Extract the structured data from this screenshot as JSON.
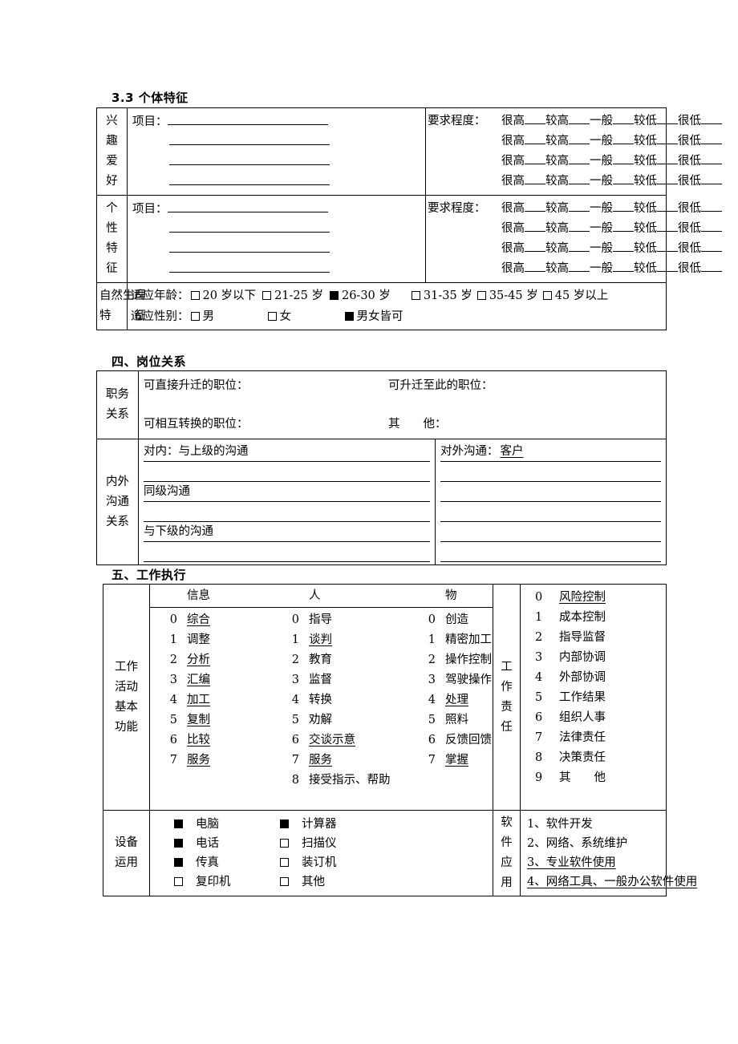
{
  "headings": {
    "individual": "3.3  个体特征",
    "relation": "四、岗位关系",
    "execution": "五、工作执行"
  },
  "individual": {
    "hobby": {
      "label": [
        "兴",
        "趣",
        "爱",
        "好"
      ],
      "item_label": "项目：",
      "rows": 4
    },
    "personality": {
      "label": [
        "个",
        "性",
        "特",
        "征"
      ],
      "item_label": "项目：",
      "rows": 4
    },
    "degree_label": "要求程度：",
    "degree_options": [
      "很高",
      "较高",
      "一般",
      "较低",
      "很低"
    ],
    "natural": {
      "label_line1": "自然生理",
      "label_line2": "特　　征",
      "age_label": "适应年龄：",
      "age_options": [
        {
          "text": "20 岁以下",
          "checked": false
        },
        {
          "text": "21-25 岁",
          "checked": false
        },
        {
          "text": "26-30 岁",
          "checked": true
        },
        {
          "text": "31-35 岁",
          "checked": false
        },
        {
          "text": "35-45 岁",
          "checked": false
        },
        {
          "text": "45 岁以上",
          "checked": false
        }
      ],
      "gender_label": "适应性别：",
      "gender_options": [
        {
          "text": "男",
          "checked": false
        },
        {
          "text": "女",
          "checked": false
        },
        {
          "text": "男女皆可",
          "checked": true
        }
      ]
    }
  },
  "relation": {
    "duty_label": [
      "职务",
      "关系"
    ],
    "promote_from": "可直接升迁的职位：",
    "promote_to": "可升迁至此的职位：",
    "transfer": "可相互转换的职位：",
    "other": "其　　他：",
    "comm_label": [
      "内外",
      "沟通",
      "关系"
    ],
    "internal": [
      "对内：与上级的沟通",
      "同级沟通",
      "与下级的沟通"
    ],
    "external_label": "对外沟通：",
    "external_value": "客户"
  },
  "execution": {
    "function_label": [
      "工作",
      "活动",
      "基本",
      "功能"
    ],
    "columns": [
      {
        "header": "信息",
        "items": [
          {
            "num": "0",
            "text": "综合",
            "underline": true
          },
          {
            "num": "1",
            "text": "调整",
            "underline": false
          },
          {
            "num": "2",
            "text": "分析",
            "underline": true
          },
          {
            "num": "3",
            "text": "汇编",
            "underline": true
          },
          {
            "num": "4",
            "text": "加工",
            "underline": true
          },
          {
            "num": "5",
            "text": "复制",
            "underline": true
          },
          {
            "num": "6",
            "text": "比较",
            "underline": true
          },
          {
            "num": "7",
            "text": "服务",
            "underline": true
          }
        ]
      },
      {
        "header": "人",
        "items": [
          {
            "num": "0",
            "text": "指导",
            "underline": false
          },
          {
            "num": "1",
            "text": "谈判",
            "underline": true
          },
          {
            "num": "2",
            "text": "教育",
            "underline": false
          },
          {
            "num": "3",
            "text": "监督",
            "underline": false
          },
          {
            "num": "4",
            "text": "转换",
            "underline": false
          },
          {
            "num": "5",
            "text": "劝解",
            "underline": false
          },
          {
            "num": "6",
            "text": "交谈示意",
            "underline": true
          },
          {
            "num": "7",
            "text": "服务",
            "underline": true
          },
          {
            "num": "8",
            "text": "接受指示、帮助",
            "underline": false
          }
        ]
      },
      {
        "header": "物",
        "items": [
          {
            "num": "0",
            "text": "创造",
            "underline": false
          },
          {
            "num": "1",
            "text": "精密加工",
            "underline": false
          },
          {
            "num": "2",
            "text": "操作控制",
            "underline": false
          },
          {
            "num": "3",
            "text": "驾驶操作",
            "underline": false
          },
          {
            "num": "4",
            "text": "处理",
            "underline": true
          },
          {
            "num": "5",
            "text": "照料",
            "underline": false
          },
          {
            "num": "6",
            "text": "反馈回馈",
            "underline": false
          },
          {
            "num": "7",
            "text": "掌握",
            "underline": true
          }
        ]
      }
    ],
    "responsibility_label": [
      "工",
      "作",
      "责",
      "任"
    ],
    "responsibility": [
      {
        "num": "0",
        "text": "风险控制",
        "underline": true
      },
      {
        "num": "1",
        "text": "成本控制",
        "underline": false
      },
      {
        "num": "2",
        "text": "指导监督",
        "underline": false
      },
      {
        "num": "3",
        "text": "内部协调",
        "underline": false
      },
      {
        "num": "4",
        "text": "外部协调",
        "underline": false
      },
      {
        "num": "5",
        "text": "工作结果",
        "underline": false
      },
      {
        "num": "6",
        "text": "组织人事",
        "underline": false
      },
      {
        "num": "7",
        "text": "法律责任",
        "underline": false
      },
      {
        "num": "8",
        "text": "决策责任",
        "underline": false
      },
      {
        "num": "9",
        "text": "其　　他",
        "underline": false
      }
    ],
    "equipment_label": [
      "设备",
      "运用"
    ],
    "equipment": [
      [
        {
          "text": "电脑",
          "checked": true
        },
        {
          "text": "计算器",
          "checked": true
        }
      ],
      [
        {
          "text": "电话",
          "checked": true
        },
        {
          "text": "扫描仪",
          "checked": false
        }
      ],
      [
        {
          "text": "传真",
          "checked": true
        },
        {
          "text": "装订机",
          "checked": false
        }
      ],
      [
        {
          "text": "复印机",
          "checked": false
        },
        {
          "text": "其他",
          "checked": false
        }
      ]
    ],
    "software_label": [
      "软",
      "件",
      "应",
      "用"
    ],
    "software": [
      {
        "text": "1、软件开发",
        "underline": false
      },
      {
        "text": "2、网络、系统维护",
        "underline": false
      },
      {
        "text": "3、专业软件使用",
        "underline": true
      },
      {
        "text": "4、网络工具、一般办公软件使用",
        "underline": true
      }
    ]
  }
}
